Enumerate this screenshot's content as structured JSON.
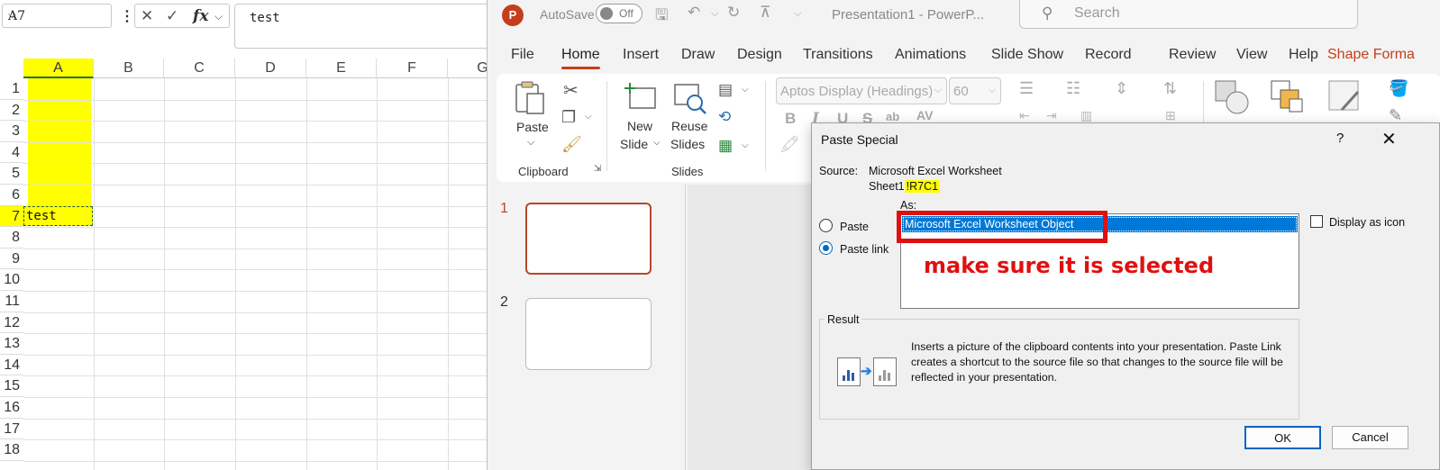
{
  "excel": {
    "name_box": "A7",
    "formula_value": "test",
    "columns": [
      "A",
      "B",
      "C",
      "D",
      "E",
      "F",
      "G"
    ],
    "rows": [
      "1",
      "2",
      "3",
      "4",
      "5",
      "6",
      "7",
      "8",
      "9",
      "10",
      "11",
      "12",
      "13",
      "14",
      "15",
      "16",
      "17",
      "18"
    ],
    "active_cell_value": "test",
    "fill_color": "#ffff00"
  },
  "powerpoint": {
    "autosave_label": "AutoSave",
    "autosave_state": "Off",
    "doc_title": "Presentation1  -  PowerP...",
    "search_placeholder": "Search",
    "tabs": [
      "File",
      "Home",
      "Insert",
      "Draw",
      "Design",
      "Transitions",
      "Animations",
      "Slide Show",
      "Record",
      "Review",
      "View",
      "Help",
      "Shape Forma"
    ],
    "active_tab": "Home",
    "ribbon": {
      "paste_label": "Paste",
      "clipboard_group": "Clipboard",
      "new_slide_line1": "New",
      "new_slide_line2": "Slide",
      "reuse_line1": "Reuse",
      "reuse_line2": "Slides",
      "slides_group": "Slides",
      "font_name": "Aptos Display (Headings)",
      "font_size": "60",
      "bold": "B",
      "italic": "I",
      "underline": "U",
      "strike": "S",
      "spacing": "ab",
      "case": "AV"
    },
    "slides": [
      "1",
      "2"
    ],
    "accent_color": "#c43e1c"
  },
  "dialog": {
    "title": "Paste Special",
    "help": "?",
    "source_label": "Source:",
    "source_name": "Microsoft Excel Worksheet",
    "source_ref_prefix": "Sheet1",
    "source_ref_highlight": "!R7C1",
    "as_label": "As:",
    "paste_option": "Paste",
    "paste_link_option": "Paste link",
    "selected_type": "Microsoft Excel Worksheet Object",
    "display_as_icon": "Display as icon",
    "annotation": "make sure it is selected",
    "result_label": "Result",
    "result_text": "Inserts a picture of the clipboard contents into your presentation. Paste Link creates a shortcut to the source file so that changes to the source file will be reflected in your presentation.",
    "ok_label": "OK",
    "cancel_label": "Cancel",
    "annotation_color": "#e01010"
  }
}
